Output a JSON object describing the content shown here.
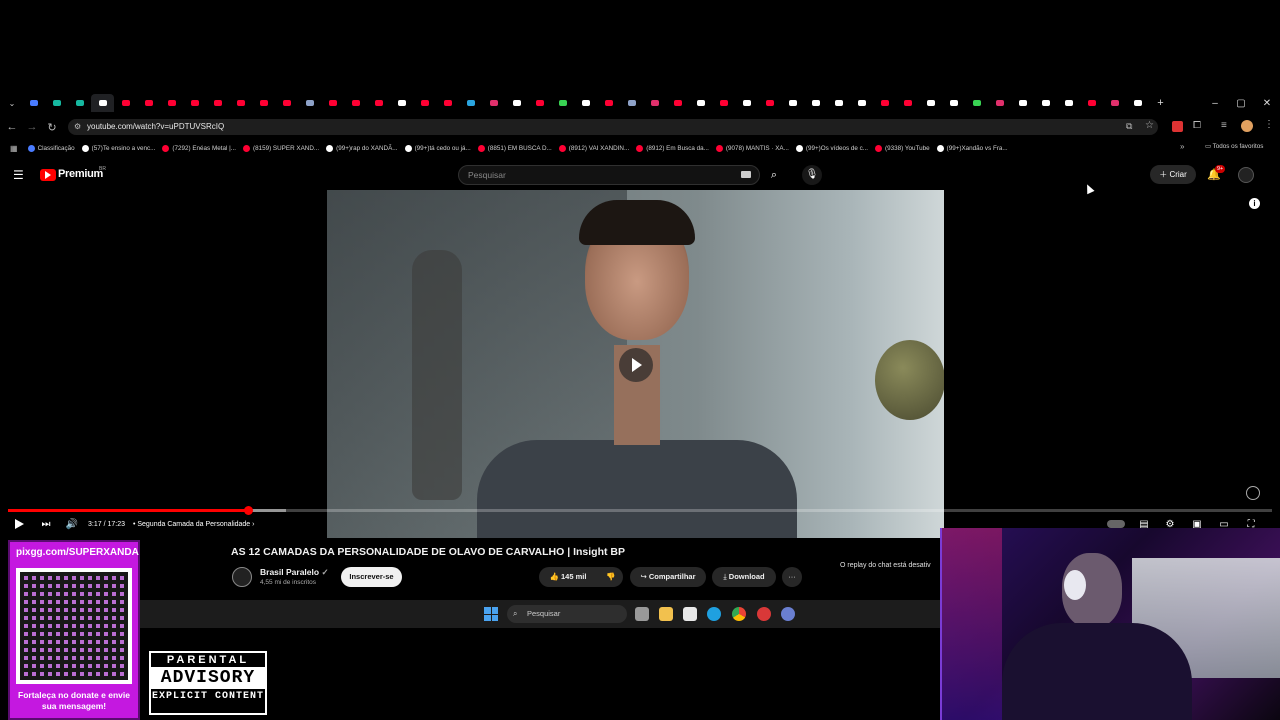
{
  "browser": {
    "url": "youtube.com/watch?v=uPDTUVSRcIQ",
    "tab_colors": [
      "#4a7cff",
      "#16b8a0",
      "#16b8a0",
      "#ffffff",
      "#ff0033",
      "#ff0033",
      "#ff0033",
      "#ff0033",
      "#ff0033",
      "#ff0033",
      "#ff0033",
      "#ff0033",
      "#8ea2c8",
      "#ff0033",
      "#ff0033",
      "#ff0033",
      "#ffffff",
      "#ff0033",
      "#ff0033",
      "#2aa5e0",
      "#e1306c",
      "#ffffff",
      "#ff0033",
      "#39d353",
      "#ffffff",
      "#ff0033",
      "#8ea2c8",
      "#e1306c",
      "#ff0033",
      "#ffffff",
      "#ff0033",
      "#ffffff",
      "#ff0033",
      "#ffffff",
      "#ffffff",
      "#ffffff",
      "#ffffff",
      "#ff0033",
      "#ff0033",
      "#ffffff",
      "#ffffff",
      "#39d353",
      "#e1306c",
      "#ffffff",
      "#ffffff",
      "#ffffff",
      "#ff0033",
      "#e1306c",
      "#ffffff"
    ],
    "new_tab": "+",
    "window_controls": {
      "minimize": "–",
      "maximize": "▢",
      "close": "✕"
    },
    "bookmarks": [
      {
        "label": "Classificação",
        "color": "#4a7cff"
      },
      {
        "label": "(57)Te ensino a venc...",
        "color": "#ffffff"
      },
      {
        "label": "(7292) Enéas Metal |...",
        "color": "#ff0033"
      },
      {
        "label": "(8159) SUPER XAND...",
        "color": "#ff0033"
      },
      {
        "label": "(99+)rap do XANDÃ...",
        "color": "#ffffff"
      },
      {
        "label": "(99+)tá cedo ou já...",
        "color": "#ffffff"
      },
      {
        "label": "(8851) EM BUSCA D...",
        "color": "#ff0033"
      },
      {
        "label": "(8912) VAI XANDIN...",
        "color": "#ff0033"
      },
      {
        "label": "(8912) Em Busca da...",
        "color": "#ff0033"
      },
      {
        "label": "(9078) MANTIS · XA...",
        "color": "#ff0033"
      },
      {
        "label": "(99+)Os vídeos de c...",
        "color": "#ffffff"
      },
      {
        "label": "(9338) YouTube",
        "color": "#ff0033"
      },
      {
        "label": "(99+)Xandão vs Fra...",
        "color": "#ffffff"
      }
    ],
    "all_bookmarks": "Todos os favoritos"
  },
  "youtube": {
    "logo": "Premium",
    "logo_country": "BR",
    "search_placeholder": "Pesquisar",
    "create_label": "Criar",
    "notif_count": "9+",
    "video": {
      "current_time": "3:17 / 17:23",
      "chapter": "Segunda Camada da Personalidade",
      "progress_fraction": 0.19,
      "buffered_fraction": 0.22,
      "title": "AS 12 CAMADAS DA PERSONALIDADE DE OLAVO DE CARVALHO | Insight BP",
      "channel": "Brasil Paralelo",
      "subscribers": "4,55 mi de inscritos",
      "subscribe_label": "Inscrever-se",
      "likes": "145 mil",
      "share_label": "Compartilhar",
      "download_label": "Download",
      "more_label": "···",
      "chat_notice": "O replay do chat está desativ"
    }
  },
  "taskbar": {
    "search_placeholder": "Pesquisar"
  },
  "overlay": {
    "donate_url": "pixgg.com/SUPERXANDA",
    "donate_message": "Fortaleça no donate e envie sua mensagem!",
    "parental_line1": "PARENTAL",
    "parental_line2": "ADVISORY",
    "parental_line3": "EXPLICIT CONTENT"
  }
}
